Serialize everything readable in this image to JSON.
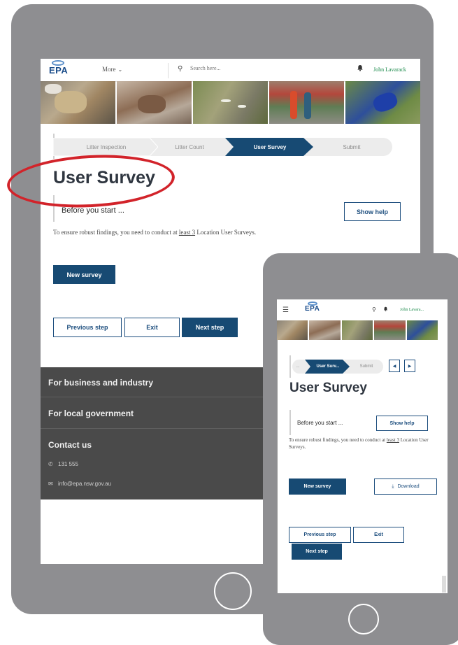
{
  "tablet": {
    "header": {
      "logo_text": "EPA",
      "more_label": "More",
      "search_placeholder": "Search here...",
      "user_name": "John Lavarack"
    },
    "stepper": {
      "steps": [
        "Litter Inspection",
        "Litter Count",
        "User Survey",
        "Submit"
      ],
      "active_index": 2
    },
    "title": "User Survey",
    "before_label": "Before you start ...",
    "show_help_label": "Show help",
    "notice": {
      "before": "To ensure robust findings, you need to conduct at ",
      "link": "least 3",
      "after": " Location User Surveys."
    },
    "new_survey_label": "New survey",
    "previous_label": "Previous step",
    "exit_label": "Exit",
    "next_label": "Next step",
    "footer": {
      "links": [
        "For business and industry",
        "For local government",
        "Contact us"
      ],
      "phone": "131 555",
      "email": "info@epa.nsw.gov.au"
    }
  },
  "phone": {
    "header": {
      "logo_text": "EPA",
      "user_name": "John Lavara..."
    },
    "stepper": {
      "steps": [
        "...",
        "User Surv...",
        "Submit"
      ],
      "active_index": 1
    },
    "title": "User Survey",
    "before_label": "Before you start ...",
    "show_help_label": "Show help",
    "notice": {
      "before": "To ensure robust findings, you need to conduct at ",
      "link": "least 3",
      "after": " Location User Surveys."
    },
    "new_survey_label": "New survey",
    "download_label": "Download",
    "previous_label": "Previous step",
    "exit_label": "Exit",
    "next_label": "Next step"
  },
  "colors": {
    "device_frame": "#8e8e91",
    "primary": "#174a73",
    "accent_user": "#1a8a4a",
    "footer": "#4a4a4a",
    "highlight_circle": "#d2232a"
  },
  "icons": [
    "logo-icon",
    "chevron-down-icon",
    "search-icon",
    "bell-icon",
    "menu-icon",
    "phone-icon",
    "mail-icon",
    "download-icon",
    "chevron-left-icon",
    "chevron-right-icon"
  ]
}
